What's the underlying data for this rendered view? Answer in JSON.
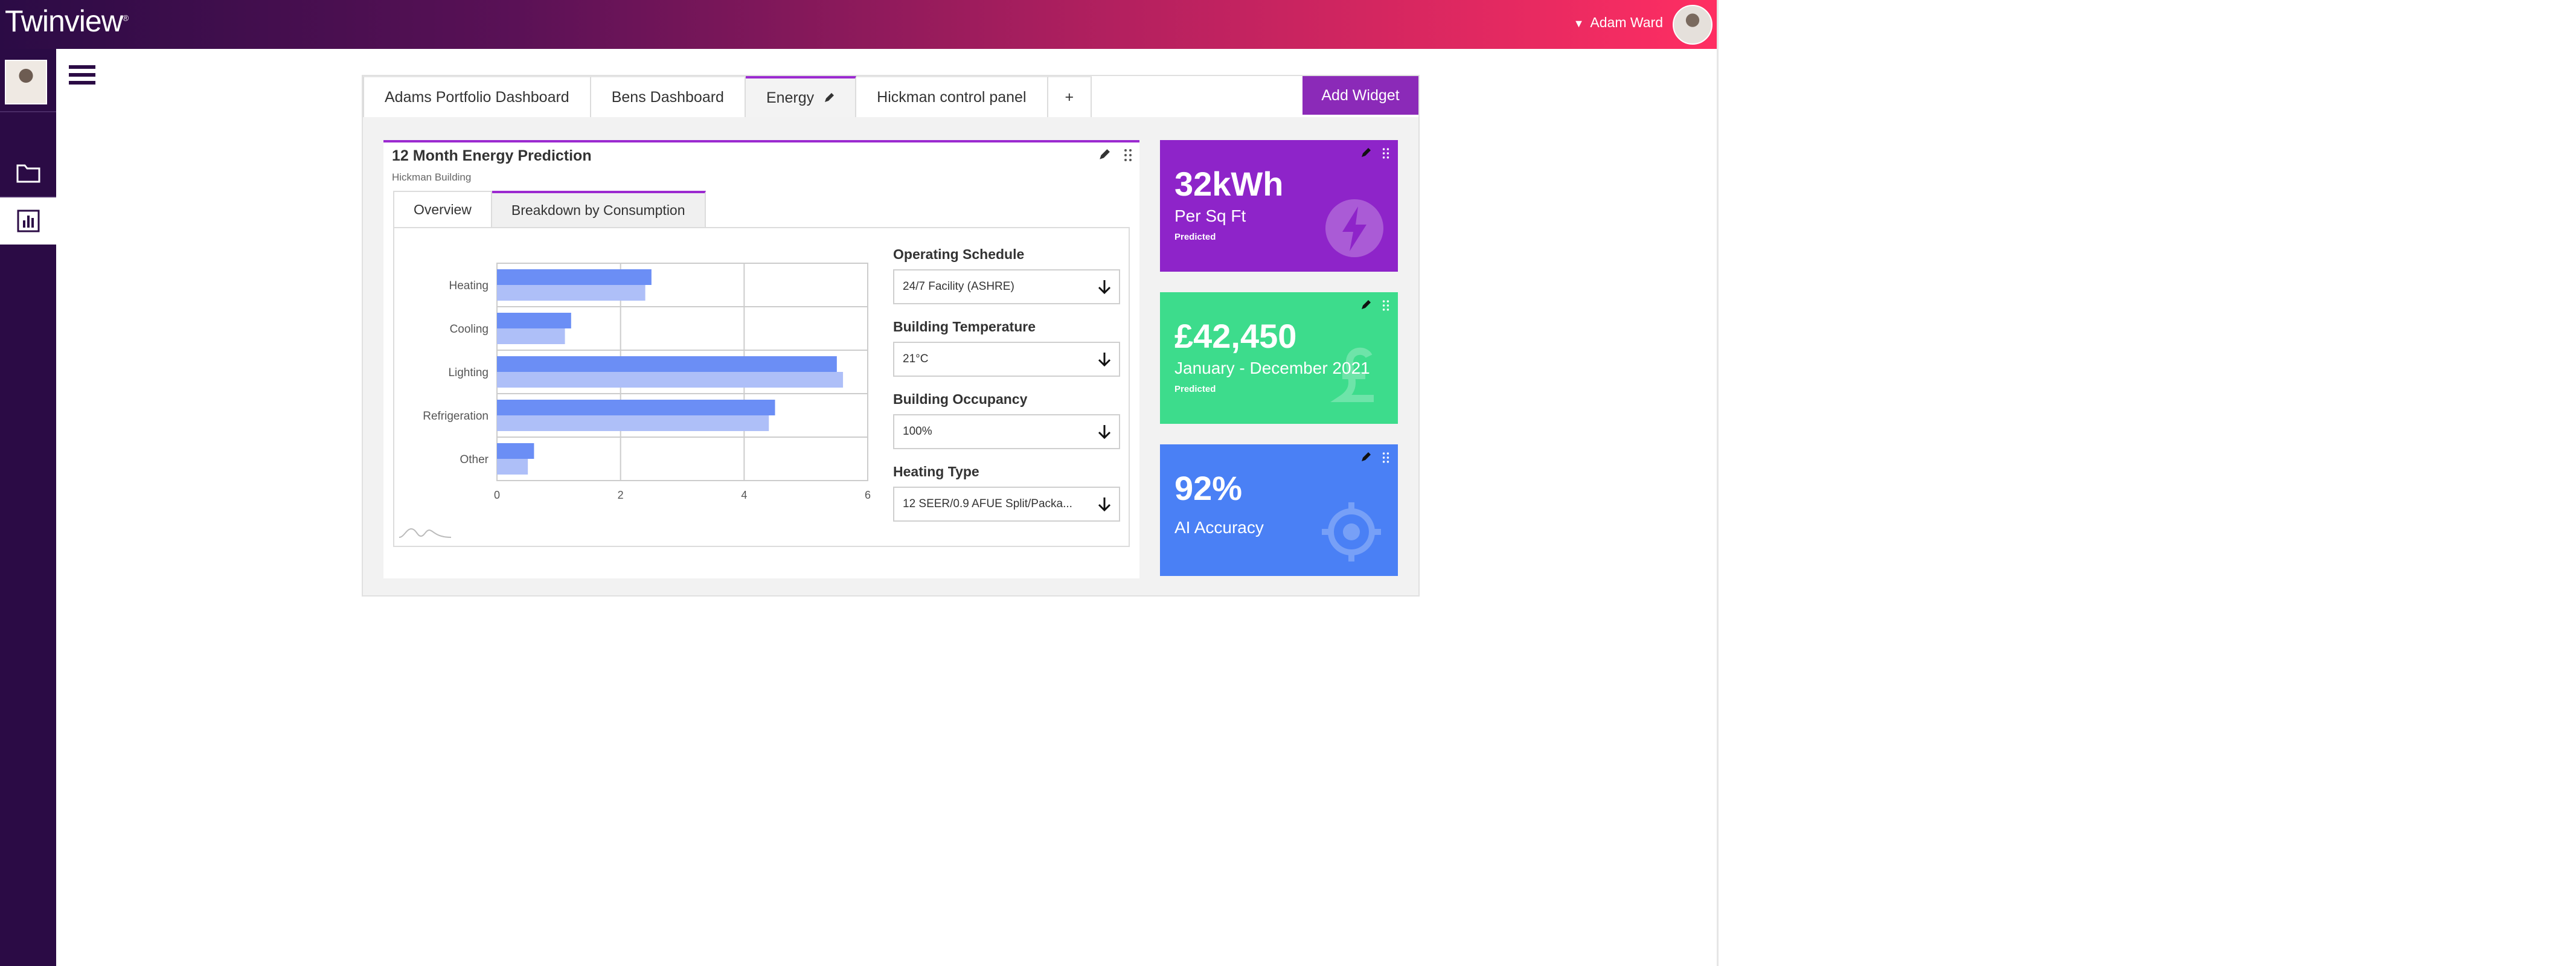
{
  "header": {
    "brand": "Twinview",
    "user_name": "Adam Ward"
  },
  "tabs": [
    {
      "label": "Adams Portfolio Dashboard"
    },
    {
      "label": "Bens Dashboard"
    },
    {
      "label": "Energy"
    },
    {
      "label": "Hickman control panel"
    },
    {
      "label": "+"
    }
  ],
  "add_widget_label": "Add Widget",
  "widget": {
    "title": "12 Month Energy Prediction",
    "subtitle": "Hickman Building",
    "inner_tabs": [
      {
        "label": "Overview"
      },
      {
        "label": "Breakdown by Consumption"
      }
    ]
  },
  "chart_data": {
    "type": "bar",
    "orientation": "horizontal",
    "categories": [
      "Heating",
      "Cooling",
      "Lighting",
      "Refrigeration",
      "Other"
    ],
    "series": [
      {
        "values": [
          2.5,
          1.2,
          5.5,
          4.5,
          0.6
        ],
        "color": "#6b8ef5"
      },
      {
        "values": [
          2.4,
          1.1,
          5.6,
          4.4,
          0.5
        ],
        "color": "#aebff8"
      }
    ],
    "xlim": [
      0,
      6
    ],
    "xticks": [
      "0",
      "2",
      "4",
      "6"
    ],
    "grid": true
  },
  "form": {
    "schedule": {
      "label": "Operating Schedule",
      "value": "24/7 Facility (ASHRE)"
    },
    "temperature": {
      "label": "Building Temperature",
      "value": "21°C"
    },
    "occupancy": {
      "label": "Building Occupancy",
      "value": "100%"
    },
    "heating": {
      "label": "Heating Type",
      "value": "12 SEER/0.9 AFUE Split/Packa..."
    }
  },
  "cards": [
    {
      "big": "32kWh",
      "mid": "Per Sq Ft",
      "small": "Predicted",
      "color": "#8e24c9",
      "icon": "lightning-icon"
    },
    {
      "big": "£42,450",
      "mid": "January - December 2021",
      "small": "Predicted",
      "color": "#3ddc8c",
      "icon": "pound-icon"
    },
    {
      "big": "92%",
      "mid": "AI Accuracy",
      "small": "",
      "color": "#4a80f5",
      "icon": "target-icon"
    }
  ]
}
